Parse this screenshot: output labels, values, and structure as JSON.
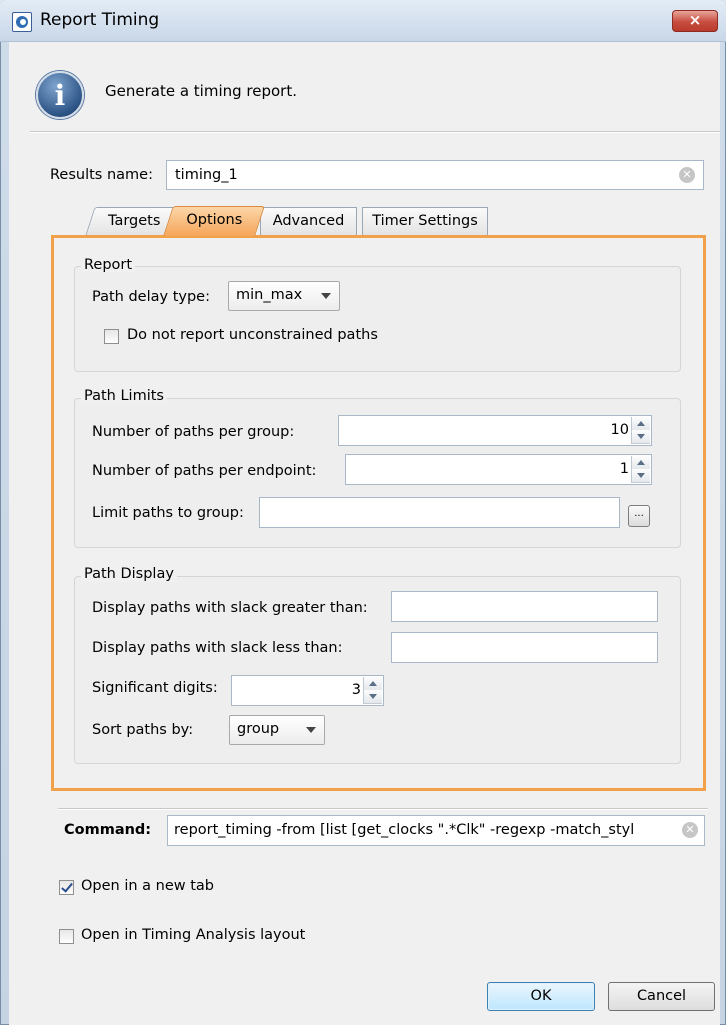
{
  "window": {
    "title": "Report Timing",
    "close_label": "×"
  },
  "header": {
    "message": "Generate a timing report.",
    "info_glyph": "i"
  },
  "results": {
    "label": "Results name:",
    "value": "timing_1"
  },
  "tabs": [
    {
      "label": "Targets",
      "active": false
    },
    {
      "label": "Options",
      "active": true
    },
    {
      "label": "Advanced",
      "active": false
    },
    {
      "label": "Timer Settings",
      "active": false
    }
  ],
  "report": {
    "title": "Report",
    "path_delay_label": "Path delay type:",
    "path_delay_value": "min_max",
    "unconstrained_label": "Do not report unconstrained paths",
    "unconstrained_checked": false
  },
  "path_limits": {
    "title": "Path Limits",
    "per_group_label": "Number of paths per group:",
    "per_group_value": "10",
    "per_endpoint_label": "Number of paths per endpoint:",
    "per_endpoint_value": "1",
    "limit_group_label": "Limit paths to group:",
    "limit_group_value": "",
    "browse_label": "..."
  },
  "path_display": {
    "title": "Path Display",
    "slack_greater_label": "Display paths with slack greater than:",
    "slack_greater_value": "",
    "slack_less_label": "Display paths with slack less than:",
    "slack_less_value": "",
    "sig_digits_label": "Significant digits:",
    "sig_digits_value": "3",
    "sort_label": "Sort paths by:",
    "sort_value": "group"
  },
  "command": {
    "label": "Command:",
    "value": "report_timing -from [list [get_clocks \".*Clk\" -regexp -match_styl"
  },
  "options": {
    "new_tab_label": "Open in a new tab",
    "new_tab_checked": true,
    "timing_layout_label": "Open in Timing Analysis layout",
    "timing_layout_checked": false
  },
  "buttons": {
    "ok": "OK",
    "cancel": "Cancel"
  },
  "colors": {
    "accent_tab": "#f5a55a",
    "panel_border": "#f0a14a",
    "close_button": "#c74d3f"
  }
}
